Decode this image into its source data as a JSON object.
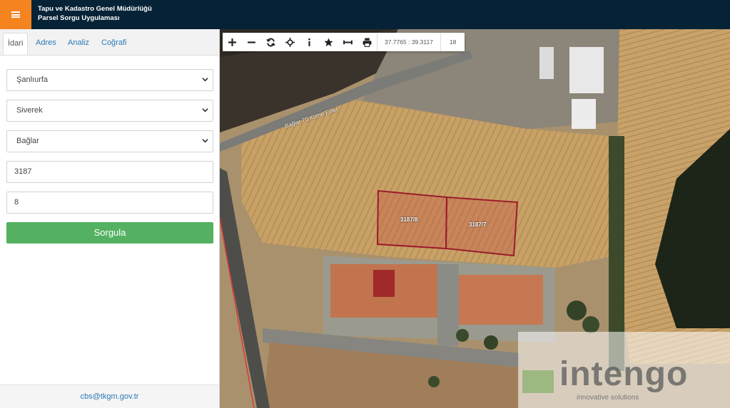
{
  "header": {
    "title_line1": "Tapu ve Kadastro Genel Müdürlüğü",
    "title_line2": "Parsel Sorgu Uygulaması",
    "menu_icon": "hamburger-icon",
    "accent_color": "#f58320",
    "bar_color": "#062236"
  },
  "tabs": [
    {
      "label": "İdari",
      "active": true
    },
    {
      "label": "Adres",
      "active": false
    },
    {
      "label": "Analiz",
      "active": false
    },
    {
      "label": "Coğrafi",
      "active": false
    }
  ],
  "form": {
    "province": "Şanlıurfa",
    "district": "Siverek",
    "neighborhood": "Bağlar",
    "block": "3187",
    "parcel": "8",
    "submit_label": "Sorgula",
    "submit_color": "#54b161"
  },
  "footer": {
    "email": "cbs@tkgm.gov.tr"
  },
  "map": {
    "toolbar_icons": [
      "zoom-in-icon",
      "zoom-out-icon",
      "refresh-icon",
      "locate-icon",
      "info-icon",
      "star-icon",
      "measure-icon",
      "print-icon"
    ],
    "coordinates": "37.7765 : 39.3117",
    "zoom_level": "18",
    "road_label": "Bağlar 70 Küme Evler",
    "parcel_labels": [
      "3187/8",
      "3187/7"
    ],
    "parcel_outline_color": "#9b1b2a",
    "watermark_text": "intengo",
    "watermark_subtext": "innovative solutions"
  }
}
